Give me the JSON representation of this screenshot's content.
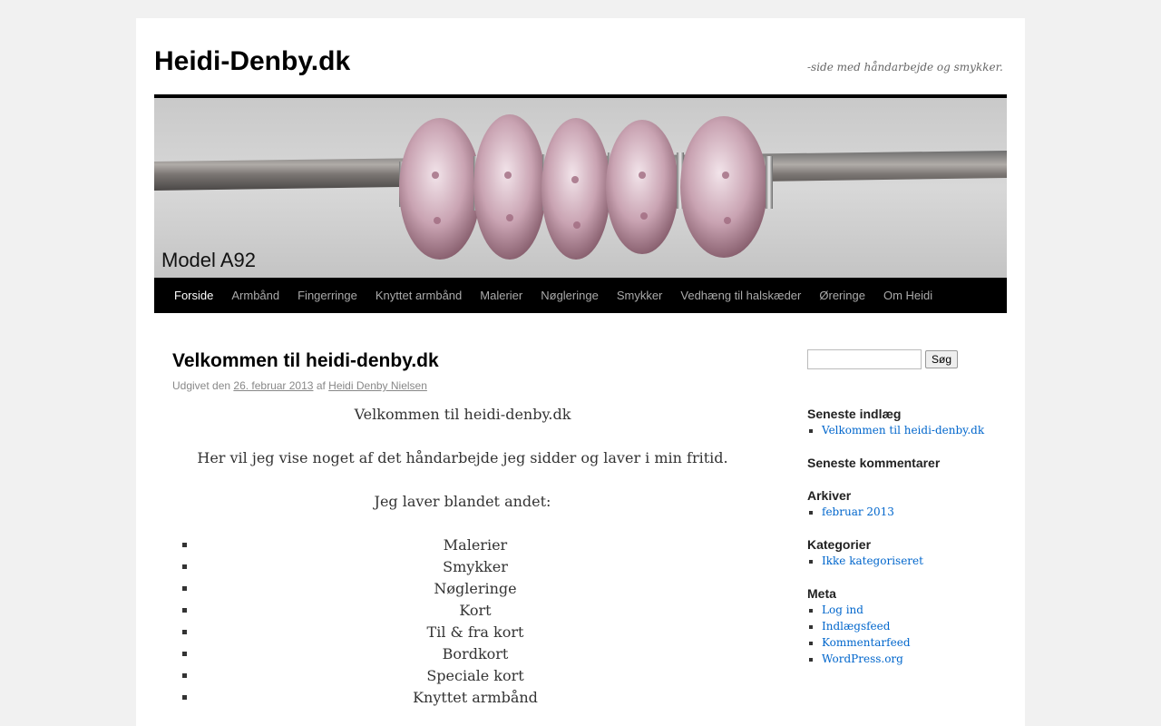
{
  "site": {
    "title": "Heidi-Denby.dk",
    "description": "-side med håndarbejde og smykker.",
    "banner_caption": "Model A92"
  },
  "nav": {
    "items": [
      {
        "label": "Forside",
        "current": true
      },
      {
        "label": "Armbånd"
      },
      {
        "label": "Fingerringe"
      },
      {
        "label": "Knyttet armbånd"
      },
      {
        "label": "Malerier"
      },
      {
        "label": "Nøgleringe"
      },
      {
        "label": "Smykker"
      },
      {
        "label": "Vedhæng til halskæder"
      },
      {
        "label": "Øreringe"
      },
      {
        "label": "Om Heidi"
      }
    ]
  },
  "post": {
    "title": "Velkommen til heidi-denby.dk",
    "meta_prefix": "Udgivet den",
    "date": "26. februar 2013",
    "meta_by": "af",
    "author": "Heidi Denby Nielsen",
    "paragraphs": [
      "Velkommen til heidi-denby.dk",
      "Her vil jeg vise noget af det håndarbejde jeg sidder og laver i min fritid.",
      "Jeg laver blandet andet:"
    ],
    "list": [
      "Malerier",
      "Smykker",
      "Nøgleringe",
      "Kort",
      "Til & fra kort",
      "Bordkort",
      "Speciale kort",
      "Knyttet armbånd"
    ]
  },
  "sidebar": {
    "search": {
      "placeholder": "",
      "button": "Søg"
    },
    "recent_posts": {
      "title": "Seneste indlæg",
      "items": [
        "Velkommen til heidi-denby.dk"
      ]
    },
    "recent_comments": {
      "title": "Seneste kommentarer"
    },
    "archives": {
      "title": "Arkiver",
      "items": [
        "februar 2013"
      ]
    },
    "categories": {
      "title": "Kategorier",
      "items": [
        "Ikke kategoriseret"
      ]
    },
    "meta": {
      "title": "Meta",
      "items": [
        "Log ind",
        "Indlægsfeed",
        "Kommentarfeed",
        "WordPress.org"
      ]
    }
  }
}
